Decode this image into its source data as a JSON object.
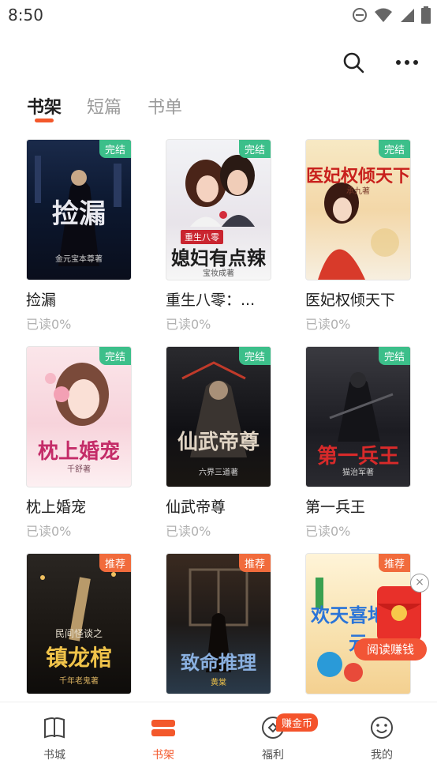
{
  "status": {
    "time": "8:50"
  },
  "tabs": [
    {
      "label": "书架",
      "active": true
    },
    {
      "label": "短篇",
      "active": false
    },
    {
      "label": "书单",
      "active": false
    }
  ],
  "books": [
    {
      "title": "捡漏",
      "progress": "已读0%",
      "badge": "完结",
      "badge_type": "done",
      "cover_title": "捡漏",
      "cover_author": "金元宝本尊著"
    },
    {
      "title": "重生八零：...",
      "progress": "已读0%",
      "badge": "完结",
      "badge_type": "done",
      "cover_title": "媳妇有点辣",
      "cover_subtitle": "重生八零",
      "cover_author": "宝妆成著"
    },
    {
      "title": "医妃权倾天下",
      "progress": "已读0%",
      "badge": "完结",
      "badge_type": "done",
      "cover_title": "医妃权倾天下",
      "cover_author": "承九著"
    },
    {
      "title": "枕上婚宠",
      "progress": "已读0%",
      "badge": "完结",
      "badge_type": "done",
      "cover_title": "枕上婚宠",
      "cover_author": "千舒著"
    },
    {
      "title": "仙武帝尊",
      "progress": "已读0%",
      "badge": "完结",
      "badge_type": "done",
      "cover_title": "仙武帝尊",
      "cover_author": "六界三道著"
    },
    {
      "title": "第一兵王",
      "progress": "已读0%",
      "badge": "完结",
      "badge_type": "done",
      "cover_title": "第一兵王",
      "cover_author": "猫治军著"
    },
    {
      "title": "",
      "progress": "",
      "badge": "推荐",
      "badge_type": "rec",
      "cover_title": "镇龙棺",
      "cover_subtitle": "民间怪谈之",
      "cover_author": "千年老鬼著"
    },
    {
      "title": "",
      "progress": "",
      "badge": "推荐",
      "badge_type": "rec",
      "cover_title": "致命推理",
      "cover_author": "黄棠"
    },
    {
      "title": "",
      "progress": "",
      "badge": "推荐",
      "badge_type": "rec",
      "cover_title": "欢天喜地建元",
      "cover_author": ""
    }
  ],
  "promo": {
    "label": "阅读赚钱",
    "close": "×"
  },
  "bottom_nav": [
    {
      "label": "书城",
      "icon": "book-open-icon",
      "active": false
    },
    {
      "label": "书架",
      "icon": "bookshelf-icon",
      "active": true
    },
    {
      "label": "福利",
      "icon": "gift-coin-icon",
      "active": false,
      "badge": "赚金币"
    },
    {
      "label": "我的",
      "icon": "smiley-face-icon",
      "active": false
    }
  ],
  "colors": {
    "accent": "#f3582b",
    "done_badge": "#3cbf8a",
    "recommend_badge": "#f16b3c"
  }
}
